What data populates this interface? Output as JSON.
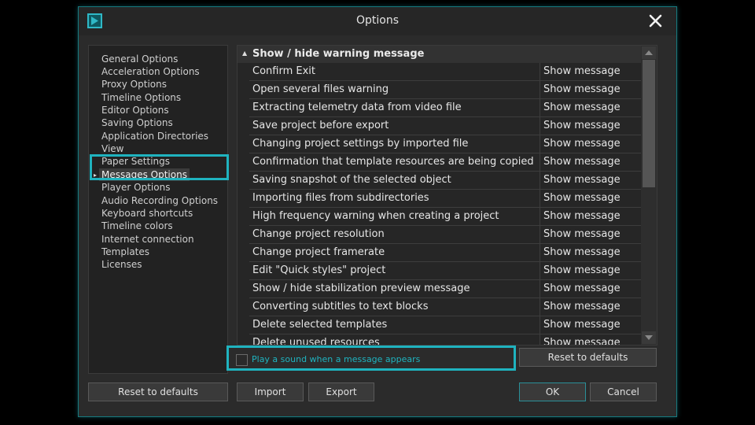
{
  "dialog": {
    "title": "Options",
    "icons": {
      "app": "play-logo-icon",
      "close": "close-icon"
    }
  },
  "nav": {
    "items": [
      {
        "label": "General Options"
      },
      {
        "label": "Acceleration Options"
      },
      {
        "label": "Proxy Options"
      },
      {
        "label": "Timeline Options"
      },
      {
        "label": "Editor Options"
      },
      {
        "label": "Saving Options"
      },
      {
        "label": "Application Directories"
      },
      {
        "label": "View"
      },
      {
        "label": "Paper Settings"
      },
      {
        "label": "Messages Options",
        "selected": true
      },
      {
        "label": "Player Options"
      },
      {
        "label": "Audio Recording Options"
      },
      {
        "label": "Keyboard shortcuts"
      },
      {
        "label": "Timeline colors"
      },
      {
        "label": "Internet connection"
      },
      {
        "label": "Templates"
      },
      {
        "label": "Licenses"
      }
    ]
  },
  "messages": {
    "group_label": "Show / hide warning message",
    "rows": [
      {
        "name": "Confirm Exit",
        "value": "Show message"
      },
      {
        "name": "Open several files warning",
        "value": "Show message"
      },
      {
        "name": "Extracting telemetry data from video file",
        "value": "Show message"
      },
      {
        "name": "Save project before export",
        "value": "Show message"
      },
      {
        "name": "Changing project settings by imported file",
        "value": "Show message"
      },
      {
        "name": "Confirmation that template resources are being copied",
        "value": "Show message"
      },
      {
        "name": "Saving snapshot of the selected object",
        "value": "Show message"
      },
      {
        "name": "Importing files from subdirectories",
        "value": "Show message"
      },
      {
        "name": "High frequency warning when creating a project",
        "value": "Show message"
      },
      {
        "name": "Change project resolution",
        "value": "Show message"
      },
      {
        "name": "Change project framerate",
        "value": "Show message"
      },
      {
        "name": "Edit \"Quick styles\" project",
        "value": "Show message"
      },
      {
        "name": "Show / hide stabilization preview message",
        "value": "Show message"
      },
      {
        "name": "Converting subtitles to text blocks",
        "value": "Show message"
      },
      {
        "name": "Delete selected templates",
        "value": "Show message"
      },
      {
        "name": "Delete unused resources",
        "value": "Show message"
      }
    ]
  },
  "sound_checkbox": {
    "label": "Play a sound when a message appears",
    "checked": false
  },
  "buttons": {
    "reset_right": "Reset to defaults",
    "reset_left": "Reset to defaults",
    "import": "Import",
    "export": "Export",
    "ok": "OK",
    "cancel": "Cancel"
  },
  "colors": {
    "accent": "#1fb3bf",
    "background": "#2b2b2b"
  }
}
